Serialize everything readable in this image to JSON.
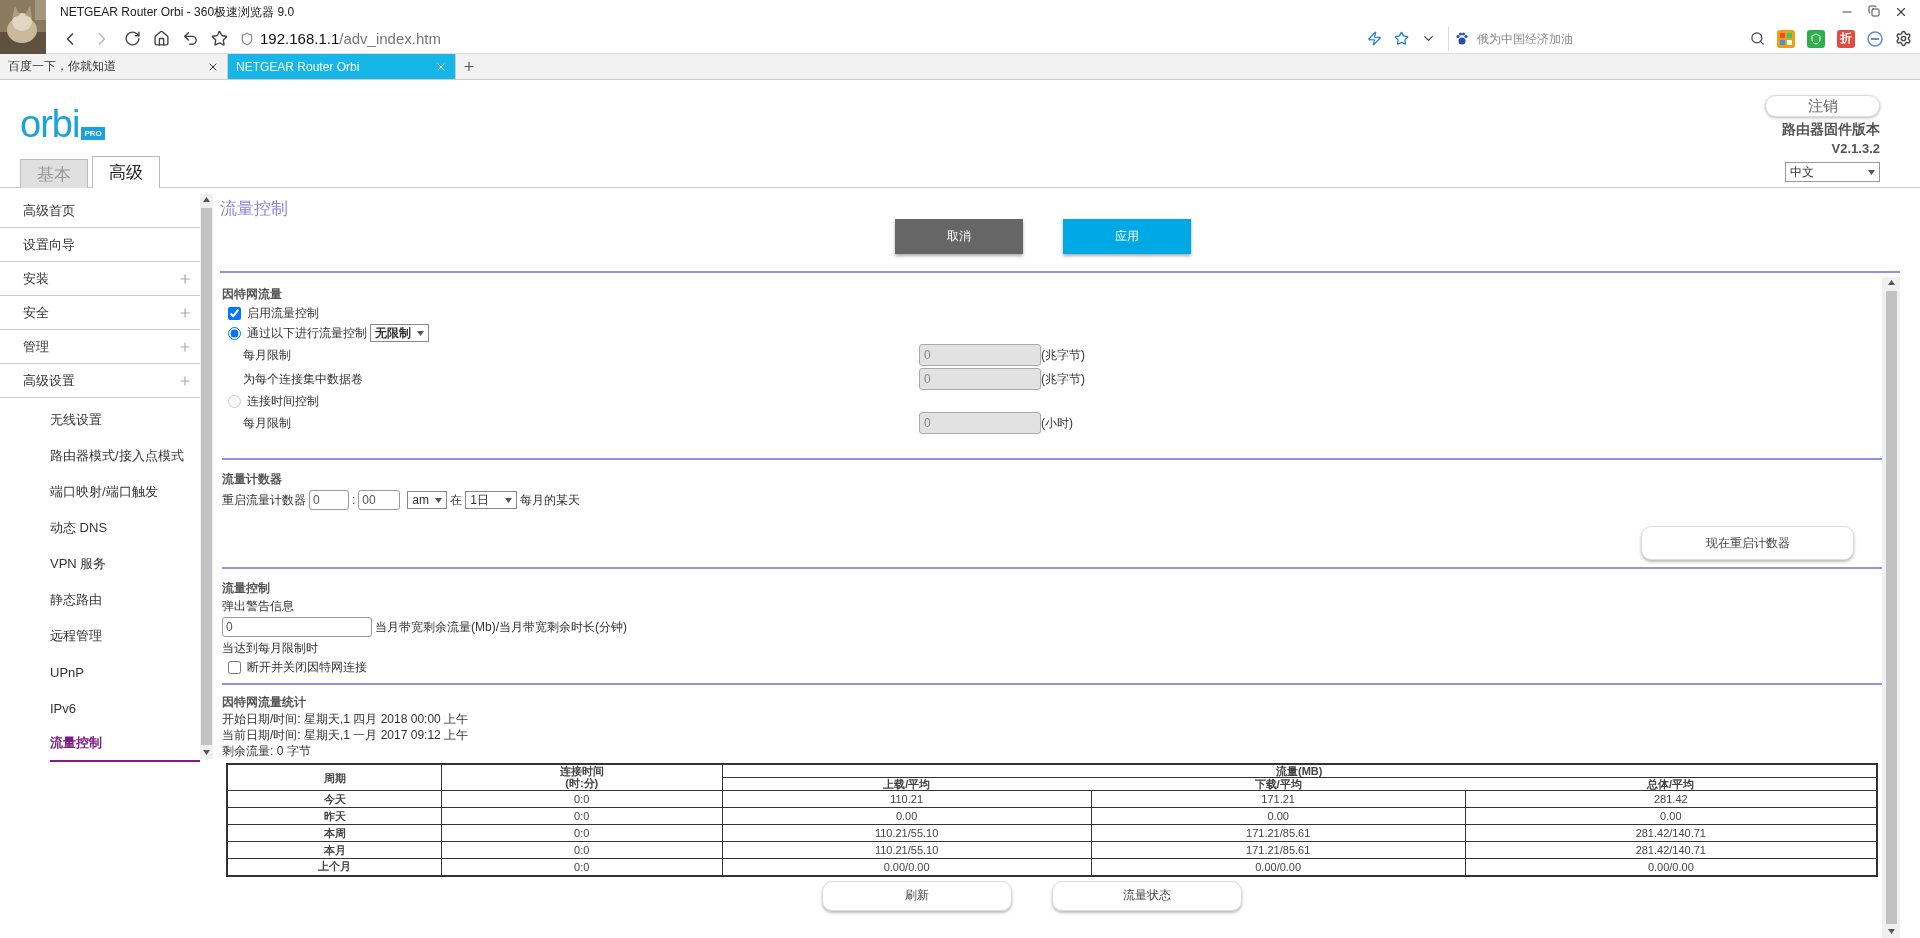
{
  "browser": {
    "title": "NETGEAR Router Orbi - 360极速浏览器 9.0",
    "url_host": "192.168.1.1",
    "url_path": "/adv_index.htm",
    "search": {
      "placeholder": "俄为中国经济加油"
    },
    "discount_badge": "折",
    "tabs": [
      {
        "label": "百度一下，你就知道",
        "selected": false
      },
      {
        "label": "NETGEAR Router Orbi",
        "selected": true
      }
    ]
  },
  "header": {
    "logo": "orbi",
    "logo_badge": "PRO",
    "logout": "注销",
    "firmware_label": "路由器固件版本",
    "firmware_version": "V2.1.3.2",
    "language": "中文"
  },
  "mode_tabs": [
    {
      "label": "基本",
      "selected": false
    },
    {
      "label": "高级",
      "selected": true
    }
  ],
  "sidebar": {
    "items": [
      {
        "label": "高级首页",
        "expandable": false
      },
      {
        "label": "设置向导",
        "expandable": false
      },
      {
        "label": "安装",
        "expandable": true
      },
      {
        "label": "安全",
        "expandable": true
      },
      {
        "label": "管理",
        "expandable": true
      },
      {
        "label": "高级设置",
        "expandable": true,
        "children": [
          {
            "label": "无线设置",
            "selected": false
          },
          {
            "label": "路由器模式/接入点模式",
            "selected": false
          },
          {
            "label": "端口映射/端口触发",
            "selected": false
          },
          {
            "label": "动态 DNS",
            "selected": false
          },
          {
            "label": "VPN 服务",
            "selected": false
          },
          {
            "label": "静态路由",
            "selected": false
          },
          {
            "label": "远程管理",
            "selected": false
          },
          {
            "label": "UPnP",
            "selected": false
          },
          {
            "label": "IPv6",
            "selected": false
          },
          {
            "label": "流量控制",
            "selected": true
          }
        ]
      }
    ]
  },
  "page": {
    "title": "流量控制",
    "buttons": [
      {
        "label": "取消",
        "kind": "secondary"
      },
      {
        "label": "应用",
        "kind": "primary"
      }
    ]
  },
  "internet_traffic": {
    "heading": "因特网流量",
    "enable": {
      "label": "启用流量控制",
      "checked": true
    },
    "by_volume": {
      "label": "通过以下进行流量控制",
      "selected": true,
      "mode": "无限制",
      "fields": [
        {
          "label": "每月限制",
          "value": "0",
          "unit": "(兆字节)",
          "disabled": true
        },
        {
          "label": "为每个连接集中数据卷",
          "value": "0",
          "unit": "(兆字节)",
          "disabled": true
        }
      ]
    },
    "by_time": {
      "label": "连接时间控制",
      "selected": false,
      "disabled": true,
      "fields": [
        {
          "label": "每月限制",
          "value": "0",
          "unit": "(小时)",
          "disabled": true
        }
      ]
    }
  },
  "counter": {
    "heading": "流量计数器",
    "label": "重启流量计数器",
    "hour": "0",
    "separator": ":",
    "minute": "00",
    "ampm": "am",
    "at": "在",
    "day": "1日",
    "suffix": "每月的某天",
    "restart_button": "现在重启计数器"
  },
  "control": {
    "heading": "流量控制",
    "popup_label": "弹出警告信息",
    "popup_value": "0",
    "popup_unit": "当月带宽剩余流量(Mb)/当月带宽剩余时长(分钟)",
    "limit_label": "当达到每月限制时",
    "disconnect": {
      "label": "断开并关闭因特网连接",
      "checked": false
    }
  },
  "stats": {
    "heading": "因特网流量统计",
    "lines": [
      "开始日期/时间: 星期天,1 四月 2018 00:00 上午",
      "当前日期/时间: 星期天,1 一月 2017 09:12 上午",
      "剩余流量: 0 字节"
    ],
    "table": {
      "period": "周期",
      "time": {
        "label": "连接时间",
        "sublabel": "(时:分)"
      },
      "traffic": "流量(MB)",
      "traffic_columns": [
        "上载/平均",
        "下载/平均",
        "总体/平均"
      ],
      "rows": [
        {
          "period": "今天",
          "time": "0:0",
          "values": [
            "110.21",
            "171.21",
            "281.42"
          ]
        },
        {
          "period": "昨天",
          "time": "0:0",
          "values": [
            "0.00",
            "0.00",
            "0.00"
          ]
        },
        {
          "period": "本周",
          "time": "0:0",
          "values": [
            "110.21/55.10",
            "171.21/85.61",
            "281.42/140.71"
          ]
        },
        {
          "period": "本月",
          "time": "0:0",
          "values": [
            "110.21/55.10",
            "171.21/85.61",
            "281.42/140.71"
          ]
        },
        {
          "period": "上个月",
          "time": "0:0",
          "values": [
            "0.00/0.00",
            "0.00/0.00",
            "0.00/0.00"
          ]
        }
      ]
    },
    "buttons": [
      "刷新",
      "流量状态"
    ]
  }
}
